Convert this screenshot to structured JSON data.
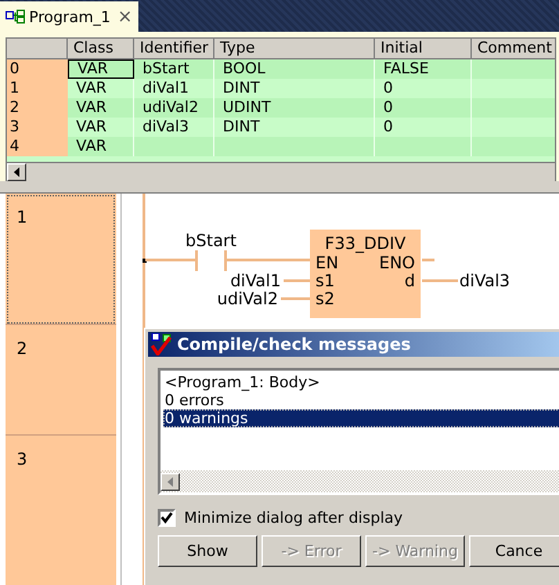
{
  "tab": {
    "title": "Program_1",
    "close": "×"
  },
  "table": {
    "columns": [
      "Class",
      "Identifier",
      "Type",
      "Initial",
      "Comment"
    ],
    "rows": [
      {
        "index": "0",
        "cells": [
          "VAR",
          "bStart",
          "BOOL",
          "FALSE",
          ""
        ],
        "focused": true
      },
      {
        "index": "1",
        "cells": [
          "VAR",
          "diVal1",
          "DINT",
          "0",
          ""
        ],
        "focused": false
      },
      {
        "index": "2",
        "cells": [
          "VAR",
          "udiVal2",
          "UDINT",
          "0",
          ""
        ],
        "focused": false
      },
      {
        "index": "3",
        "cells": [
          "VAR",
          "diVal3",
          "DINT",
          "0",
          ""
        ],
        "focused": false
      },
      {
        "index": "4",
        "cells": [
          "VAR",
          "",
          "",
          "",
          ""
        ],
        "focused": false
      }
    ]
  },
  "networks": [
    {
      "number": "1",
      "selected": true
    },
    {
      "number": "2",
      "selected": false
    },
    {
      "number": "3",
      "selected": false
    }
  ],
  "ladder": {
    "contact": "bStart",
    "block": "F33_DDIV",
    "en": "EN",
    "eno": "ENO",
    "inputs": [
      {
        "pin": "s1",
        "variable": "diVal1"
      },
      {
        "pin": "s2",
        "variable": "udiVal2"
      }
    ],
    "output": {
      "pin": "d",
      "variable": "diVal3"
    }
  },
  "dialog": {
    "title": "Compile/check messages",
    "messages": [
      {
        "text": "<Program_1: Body>",
        "selected": false
      },
      {
        "text": "0 errors",
        "selected": false
      },
      {
        "text": "0 warnings",
        "selected": true
      }
    ],
    "checkbox": {
      "label": "Minimize dialog after display",
      "checked": true
    },
    "buttons": [
      {
        "label": "Show",
        "disabled": false
      },
      {
        "label": "-> Error",
        "disabled": true
      },
      {
        "label": "-> Warning",
        "disabled": true
      },
      {
        "label": "Cance",
        "disabled": false
      }
    ]
  }
}
